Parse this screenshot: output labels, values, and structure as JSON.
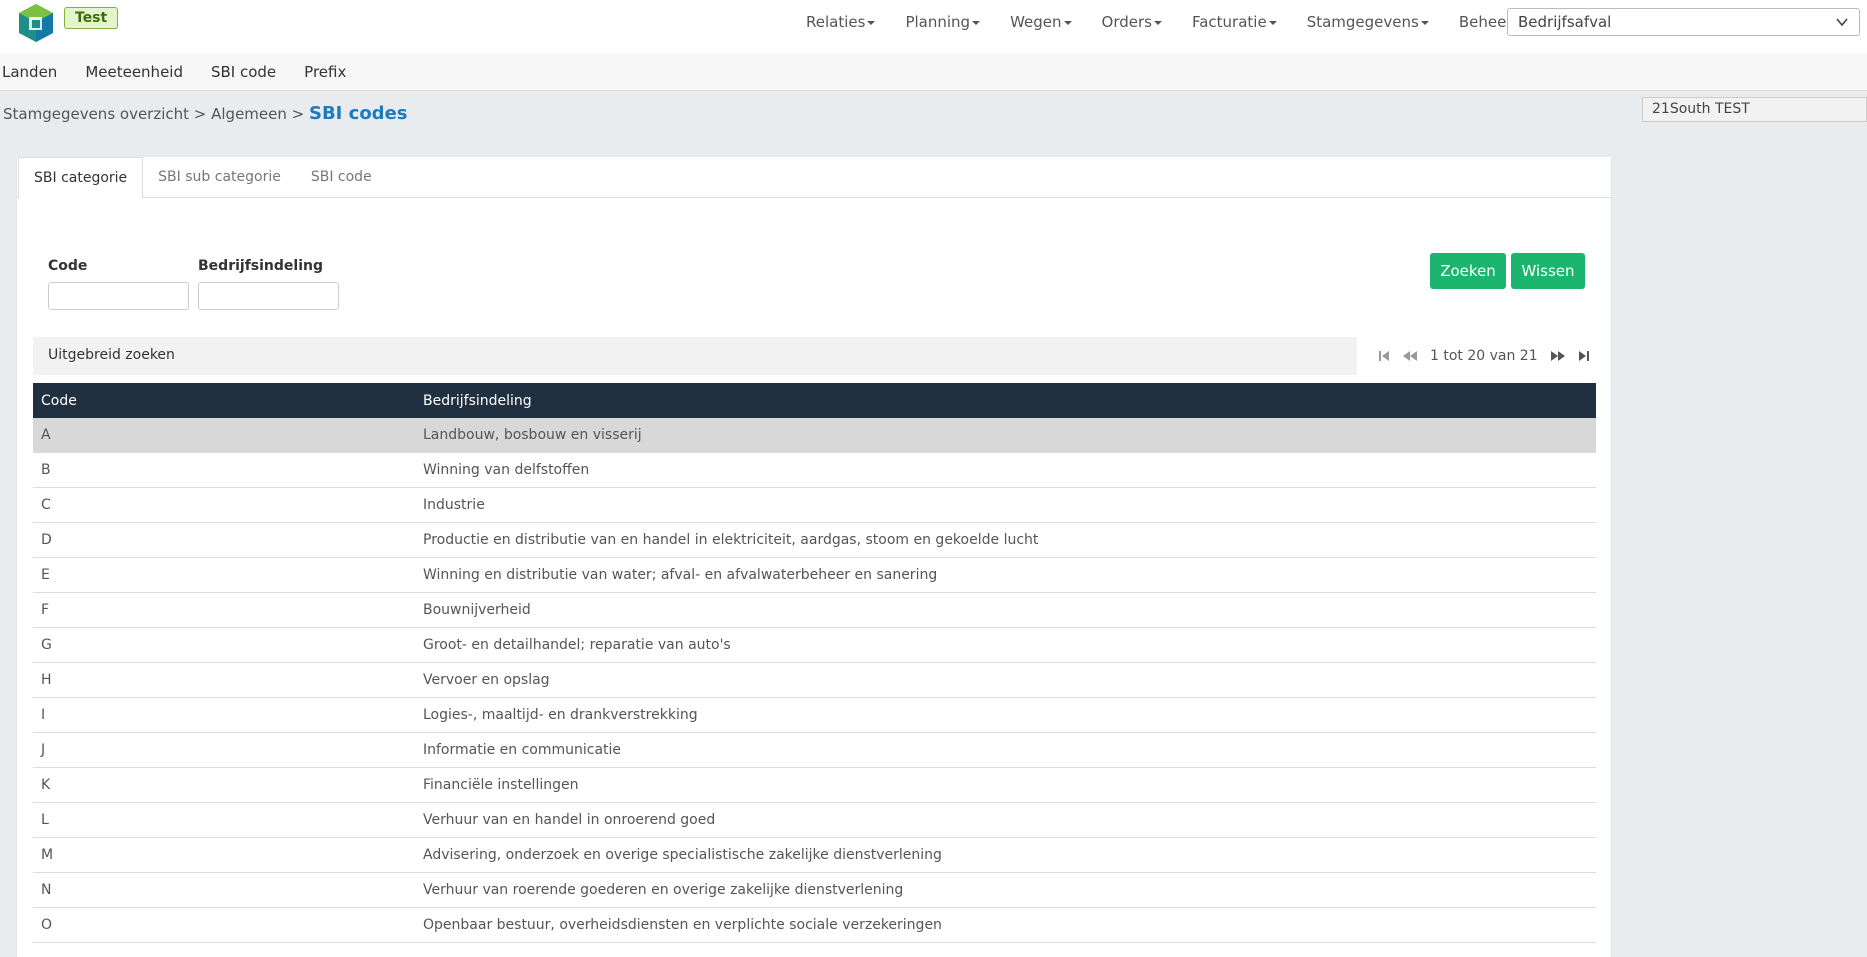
{
  "header": {
    "env_badge": "Test",
    "nav": [
      {
        "label": "Relaties"
      },
      {
        "label": "Planning"
      },
      {
        "label": "Wegen"
      },
      {
        "label": "Orders"
      },
      {
        "label": "Facturatie"
      },
      {
        "label": "Stamgegevens"
      },
      {
        "label": "Beheer"
      }
    ],
    "company_select": "Bedrijfsafval"
  },
  "subnav": [
    "Landen",
    "Meeteenheid",
    "SBI code",
    "Prefix"
  ],
  "breadcrumb": {
    "path": "Stamgegevens overzicht > Algemeen > ",
    "current": "SBI codes"
  },
  "tenant": "21South TEST",
  "tabs": [
    "SBI categorie",
    "SBI sub categorie",
    "SBI code"
  ],
  "filters": {
    "code_label": "Code",
    "code_value": "",
    "desc_label": "Bedrijfsindeling",
    "desc_value": ""
  },
  "buttons": {
    "search": "Zoeken",
    "clear": "Wissen"
  },
  "advanced_search": "Uitgebreid zoeken",
  "pager": {
    "text": "1 tot 20 van 21"
  },
  "table": {
    "headers": [
      "Code",
      "Bedrijfsindeling"
    ],
    "rows": [
      [
        "A",
        "Landbouw, bosbouw en visserij"
      ],
      [
        "B",
        "Winning van delfstoffen"
      ],
      [
        "C",
        "Industrie"
      ],
      [
        "D",
        "Productie en distributie van en handel in elektriciteit, aardgas, stoom en gekoelde lucht"
      ],
      [
        "E",
        "Winning en distributie van water; afval- en afvalwaterbeheer en sanering"
      ],
      [
        "F",
        "Bouwnijverheid"
      ],
      [
        "G",
        "Groot- en detailhandel; reparatie van auto's"
      ],
      [
        "H",
        "Vervoer en opslag"
      ],
      [
        "I",
        "Logies-, maaltijd- en drankverstrekking"
      ],
      [
        "J",
        "Informatie en communicatie"
      ],
      [
        "K",
        "Financiële instellingen"
      ],
      [
        "L",
        "Verhuur van en handel in onroerend goed"
      ],
      [
        "M",
        "Advisering, onderzoek en overige specialistische zakelijke dienstverlening"
      ],
      [
        "N",
        "Verhuur van roerende goederen en overige zakelijke dienstverlening"
      ],
      [
        "O",
        "Openbaar bestuur, overheidsdiensten en verplichte sociale verzekeringen"
      ]
    ]
  },
  "colors": {
    "accent": "#1a7bbf",
    "button": "#1bb56e",
    "table_header": "#203040",
    "selected_row": "#d8d8d8"
  }
}
